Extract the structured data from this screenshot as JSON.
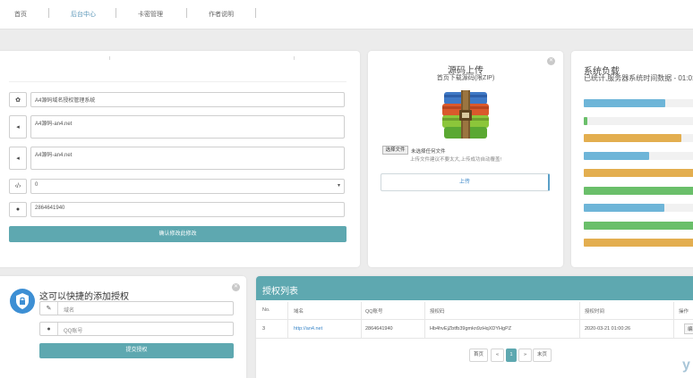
{
  "nav": {
    "items": [
      {
        "label": "首页"
      },
      {
        "label": "后台中心"
      },
      {
        "label": "卡密管理"
      },
      {
        "label": "作者说明"
      }
    ]
  },
  "settings": {
    "site_name": "A4源码域名授权管理系统",
    "field2": "A4源码-an4.net",
    "field3": "A4源码-an4.net",
    "select_value": "0",
    "qq": "2864641940",
    "save_label": "确认修改此修改"
  },
  "upload": {
    "title": "源码上传",
    "subtitle": "首页下载源码(限ZIP)",
    "choose_file": "选择文件",
    "no_file": "未选择任何文件",
    "hint": "上传文件建议不要太大,上传成功自动覆盖!",
    "upload_button": "上传"
  },
  "load": {
    "title": "系统负载",
    "subtitle": "已统计,服务器系统时间数据 - 01:01:3",
    "bars": [
      {
        "level": 0.65,
        "color": "#6eb5d8"
      },
      {
        "level": 0.03,
        "color": "#6abf6a"
      },
      {
        "level": 0.78,
        "color": "#e3ae4f"
      },
      {
        "level": 0.52,
        "color": "#6eb5d8"
      },
      {
        "level": 1.0,
        "color": "#e3ae4f"
      },
      {
        "level": 1.0,
        "color": "#6abf6a"
      },
      {
        "level": 0.64,
        "color": "#6eb5d8"
      },
      {
        "level": 1.0,
        "color": "#6abf6a"
      },
      {
        "level": 1.0,
        "color": "#e3ae4f"
      }
    ]
  },
  "quick": {
    "title": "这可以快捷的添加授权",
    "domain_placeholder": "域名",
    "qq_placeholder": "QQ账号",
    "submit_label": "提交授权"
  },
  "list": {
    "title": "授权列表",
    "headers": [
      "No.",
      "域名",
      "QQ账号",
      "授权码",
      "授权时间",
      "操作"
    ],
    "rows": [
      {
        "no": "3",
        "domain": "http://an4.net",
        "qq": "2864641940",
        "code": "Hb4hvEjZbtfb39gmkn9zHqXDYHgPZ",
        "time": "2020-03-21 01:00:26",
        "op": "编辑"
      }
    ],
    "pagination": {
      "first": "首页",
      "prev": "«",
      "current": "1",
      "next": "»",
      "last": "末页"
    }
  },
  "watermark": "y",
  "colors": {
    "accent": "#5ea8b0",
    "link": "#3a86c8",
    "shield": "#3d8fd4"
  }
}
